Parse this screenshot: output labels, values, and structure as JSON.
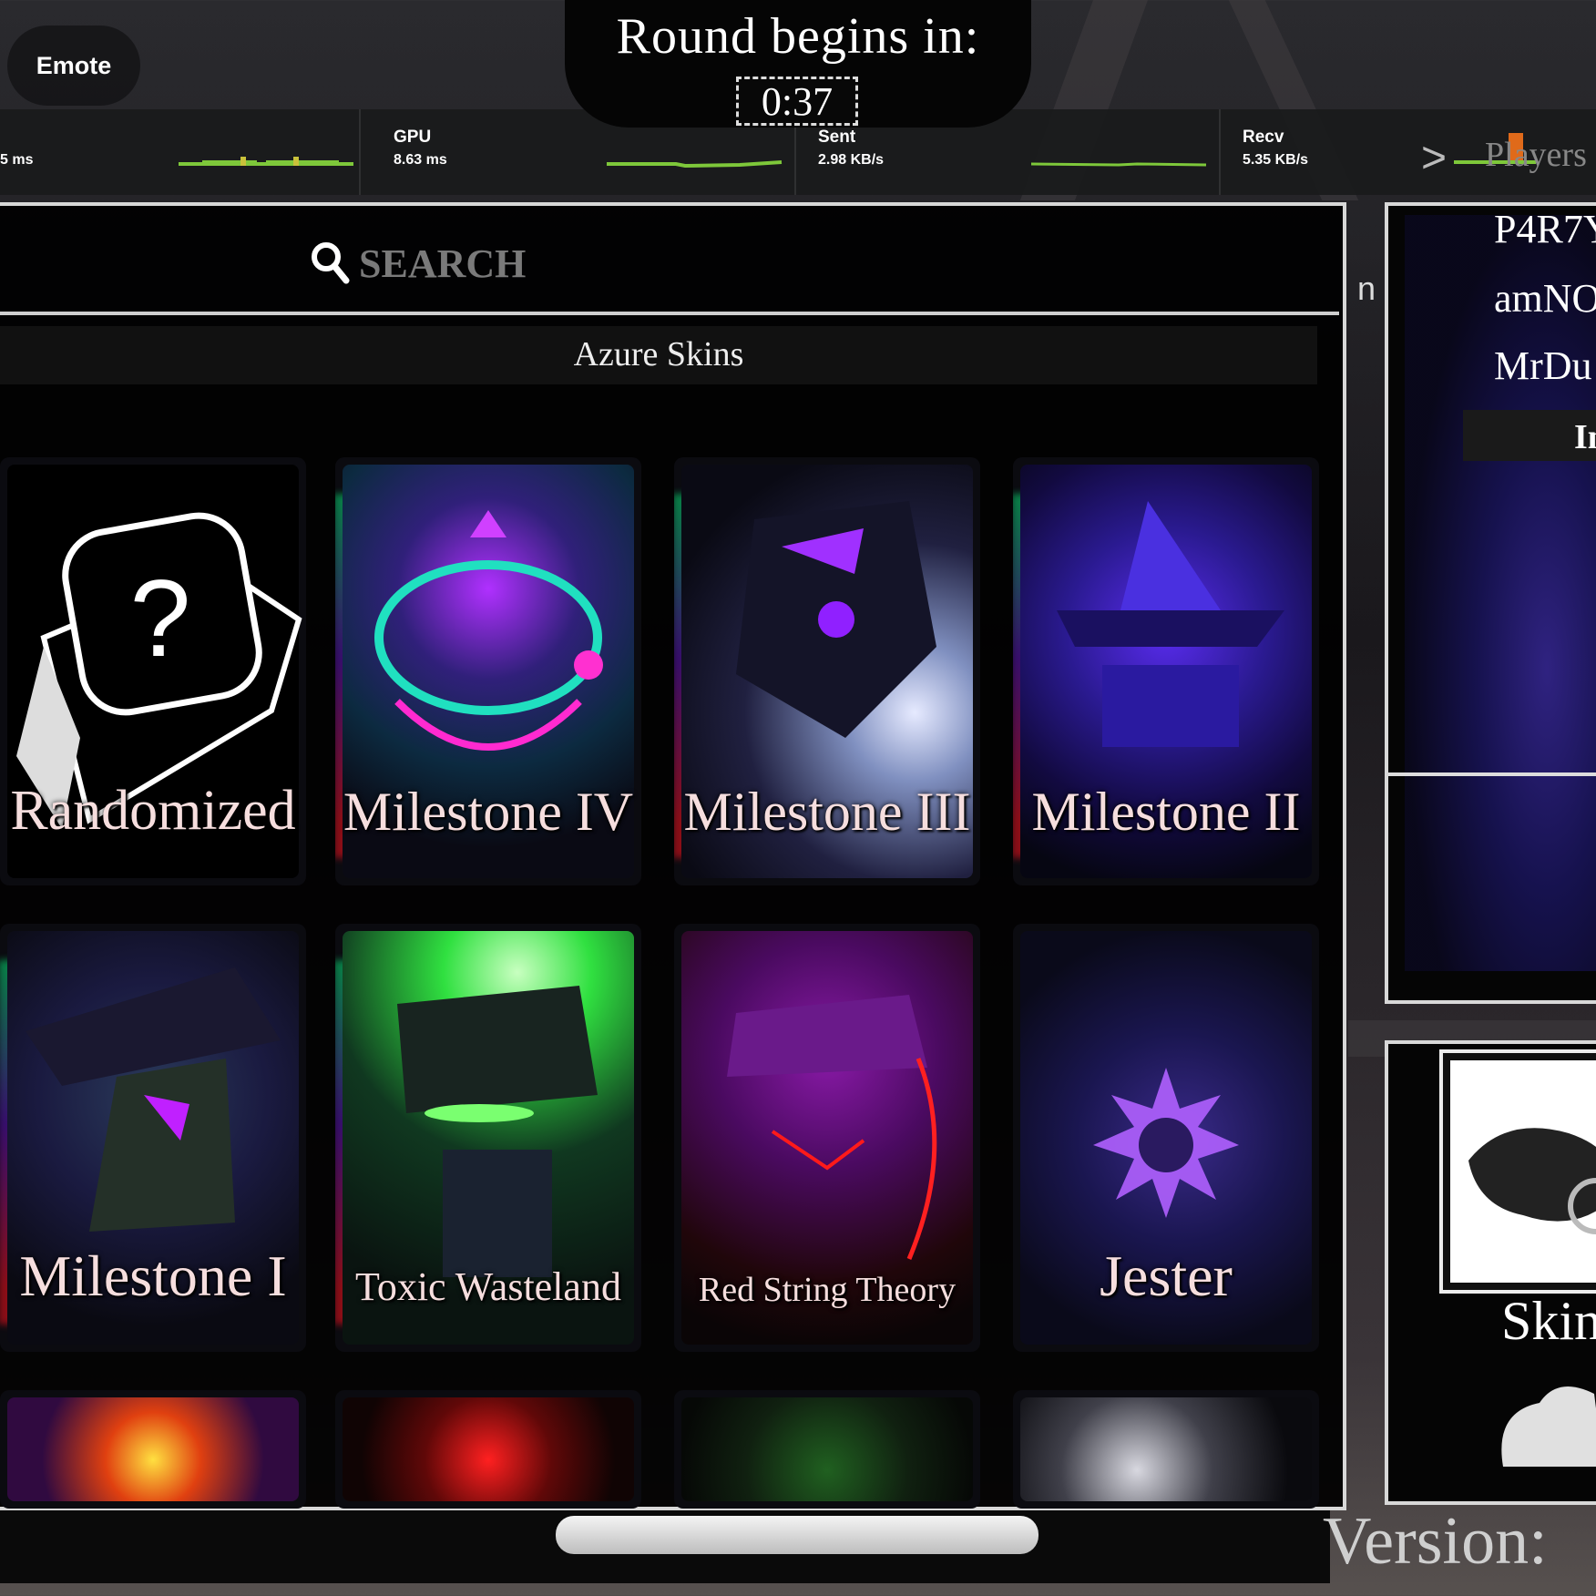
{
  "hud": {
    "emote_label": "Emote",
    "round_title": "Round begins in:",
    "timer": "0:37"
  },
  "stats": [
    {
      "name": "",
      "value": "5 ms"
    },
    {
      "name": "GPU",
      "value": "8.63 ms"
    },
    {
      "name": "Sent",
      "value": "2.98 KB/s"
    },
    {
      "name": "Recv",
      "value": "5.35 KB/s"
    }
  ],
  "players": {
    "toggle_label": ">",
    "header": "Players",
    "names": [
      "P4R7Y",
      "amNO",
      "MrDu"
    ],
    "button_label": "In"
  },
  "search": {
    "placeholder": "SEARCH"
  },
  "section_title": "Azure Skins",
  "skins": [
    {
      "label": "Randomized"
    },
    {
      "label": "Milestone IV"
    },
    {
      "label": "Milestone III"
    },
    {
      "label": "Milestone II"
    },
    {
      "label": "Milestone I"
    },
    {
      "label": "Toxic Wasteland"
    },
    {
      "label": "Red String Theory"
    },
    {
      "label": "Jester"
    }
  ],
  "equipped": {
    "label": "Skin"
  },
  "version_label": "Version:",
  "side_glyph": "n",
  "colors": {
    "accent_green": "#7ec83a",
    "label_pink": "#f6dede",
    "panel_border": "#d8d8d8"
  }
}
